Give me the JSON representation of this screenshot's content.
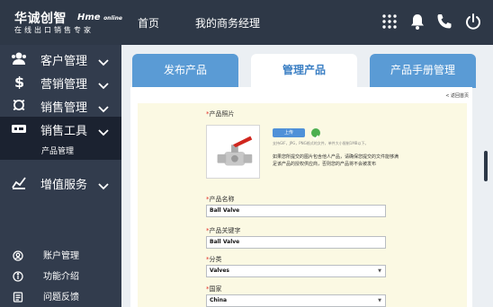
{
  "header": {
    "logo_cn": "华诚创智",
    "logo_en": "Hme",
    "logo_en_small": "online",
    "logo_tagline": "在线出口销售专家",
    "nav": [
      "首页",
      "我的商务经理"
    ],
    "icons": [
      "grid-icon",
      "bell-icon",
      "phone-icon",
      "power-icon"
    ]
  },
  "sidebar": {
    "items": [
      {
        "label": "客户管理",
        "icon": "customers-icon"
      },
      {
        "label": "营销管理",
        "icon": "dollar-icon"
      },
      {
        "label": "销售管理",
        "icon": "sales-icon"
      },
      {
        "label": "销售工具",
        "icon": "tools-icon",
        "expanded": true
      },
      {
        "label": "增值服务",
        "icon": "chart-icon"
      }
    ],
    "sub_item": "产品管理",
    "footer": [
      {
        "label": "账户管理",
        "icon": "account-icon"
      },
      {
        "label": "功能介绍",
        "icon": "info-icon"
      },
      {
        "label": "问题反馈",
        "icon": "feedback-icon"
      }
    ]
  },
  "main": {
    "tabs": [
      "发布产品",
      "管理产品",
      "产品手册管理"
    ],
    "active_tab": "管理产品",
    "back_link": "< 返回首页",
    "form": {
      "photo_label": "产品照片",
      "upload_button": "上传",
      "upload_hint": "支持GIF，JPG，PNG格式的文件，单件大小限制1MB以下。",
      "upload_note": "如果您所提交的图片包含他人产品，请确保您提交的文件能够满足该产品的授权供应商，否则您的产品将不会被发布",
      "fields": [
        {
          "label": "产品名称",
          "value": "Ball Valve",
          "type": "text"
        },
        {
          "label": "产品关键字",
          "value": "Ball Valve",
          "type": "text"
        },
        {
          "label": "分类",
          "value": "Valves",
          "type": "select"
        },
        {
          "label": "国家",
          "value": "China",
          "type": "select"
        }
      ]
    }
  },
  "colors": {
    "topbar": "#2e3847",
    "sidebar": "#323c4d",
    "sidebar_active": "#1b2230",
    "tab_blue": "#5a9bd5",
    "tab_active_text": "#3b7fc4",
    "form_bg": "#fbf9e3",
    "required": "#e2322a"
  }
}
